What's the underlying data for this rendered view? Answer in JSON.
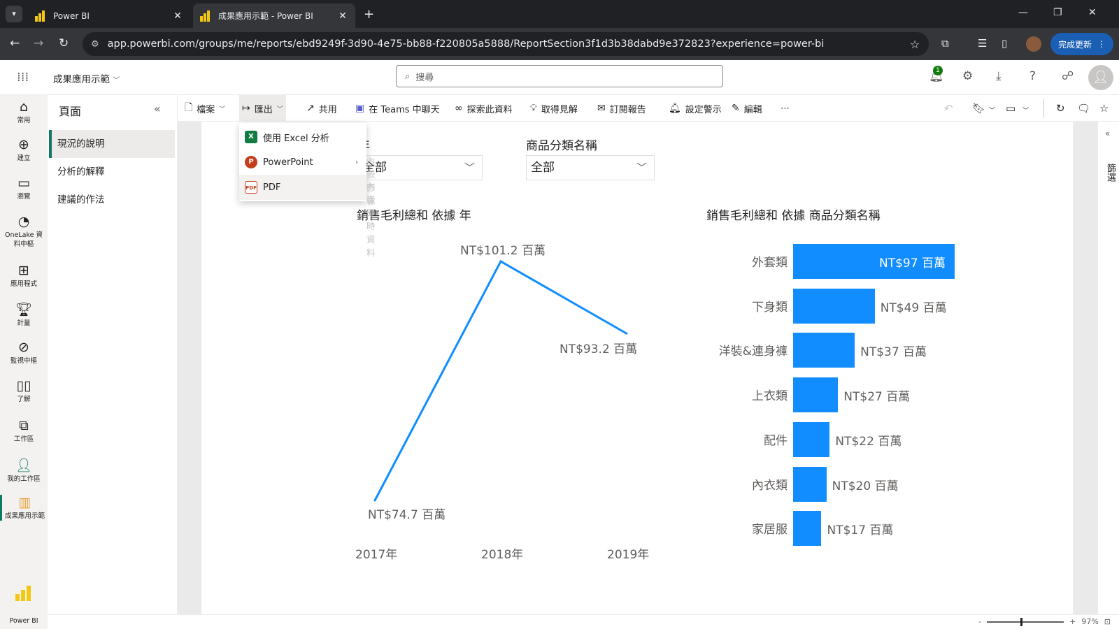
{
  "browser": {
    "tabs": [
      {
        "title": "Power BI",
        "active": false
      },
      {
        "title": "成果應用示範 - Power BI",
        "active": true
      }
    ],
    "url": "app.powerbi.com/groups/me/reports/ebd9249f-3d90-4e75-bb88-f220805a5888/ReportSection3f1d3b38dabd9e372823?experience=power-bi",
    "update_button": "完成更新"
  },
  "header": {
    "app_title": "成果應用示範",
    "search_placeholder": "搜尋",
    "notification_count": "1"
  },
  "leftnav": {
    "items": [
      {
        "label": "常用",
        "icon": "home-icon"
      },
      {
        "label": "建立",
        "icon": "create-icon"
      },
      {
        "label": "瀏覽",
        "icon": "browse-icon"
      },
      {
        "label": "OneLake 資料中樞",
        "icon": "onelake-icon"
      },
      {
        "label": "應用程式",
        "icon": "apps-icon"
      },
      {
        "label": "計量",
        "icon": "metrics-icon"
      },
      {
        "label": "監視中樞",
        "icon": "monitor-icon"
      },
      {
        "label": "了解",
        "icon": "learn-icon"
      },
      {
        "label": "工作區",
        "icon": "workspaces-icon"
      },
      {
        "label": "我的工作區",
        "icon": "my-workspace-icon"
      },
      {
        "label": "成果應用示範",
        "icon": "report-icon",
        "active": true
      }
    ],
    "brand": "Power BI"
  },
  "pages": {
    "title": "頁面",
    "items": [
      {
        "label": "現況的說明",
        "active": true
      },
      {
        "label": "分析的解釋",
        "active": false
      },
      {
        "label": "建議的作法",
        "active": false
      }
    ]
  },
  "toolbar": {
    "file": "檔案",
    "export": "匯出",
    "share": "共用",
    "teams": "在 Teams 中聊天",
    "explore": "探索此資料",
    "insights": "取得見解",
    "subscribe": "訂閱報告",
    "alert": "設定警示",
    "edit": "編輯",
    "more": "⋯"
  },
  "export_menu": {
    "items": [
      {
        "label": "使用 Excel 分析",
        "icon": "excel-icon"
      },
      {
        "label": "PowerPoint",
        "icon": "powerpoint-icon",
        "has_submenu": true
      },
      {
        "label": "PDF",
        "icon": "pdf-icon"
      }
    ],
    "ghost_items": [
      "內嵌影像",
      "內嵌即時資料"
    ]
  },
  "slicers": {
    "year": {
      "title": "年",
      "value": "全部"
    },
    "category": {
      "title": "商品分類名稱",
      "value": "全部"
    }
  },
  "right_strip": {
    "label": "篩選"
  },
  "status": {
    "zoom": "97%"
  },
  "chart_data": [
    {
      "type": "line",
      "title": "銷售毛利總和 依據 年",
      "categories": [
        "2017年",
        "2018年",
        "2019年"
      ],
      "values": [
        74.7,
        101.2,
        93.2
      ],
      "data_labels": [
        "NT$74.7 百萬",
        "NT$101.2 百萬",
        "NT$93.2 百萬"
      ],
      "color": "#118dff"
    },
    {
      "type": "bar",
      "orientation": "horizontal",
      "title": "銷售毛利總和 依據 商品分類名稱",
      "categories": [
        "外套類",
        "下身類",
        "洋裝&連身褲",
        "上衣類",
        "配件",
        "內衣類",
        "家居服"
      ],
      "values": [
        97,
        49,
        37,
        27,
        22,
        20,
        17
      ],
      "data_labels": [
        "NT$97 百萬",
        "NT$49 百萬",
        "NT$37 百萬",
        "NT$27 百萬",
        "NT$22 百萬",
        "NT$20 百萬",
        "NT$17 百萬"
      ],
      "color": "#118dff"
    }
  ]
}
